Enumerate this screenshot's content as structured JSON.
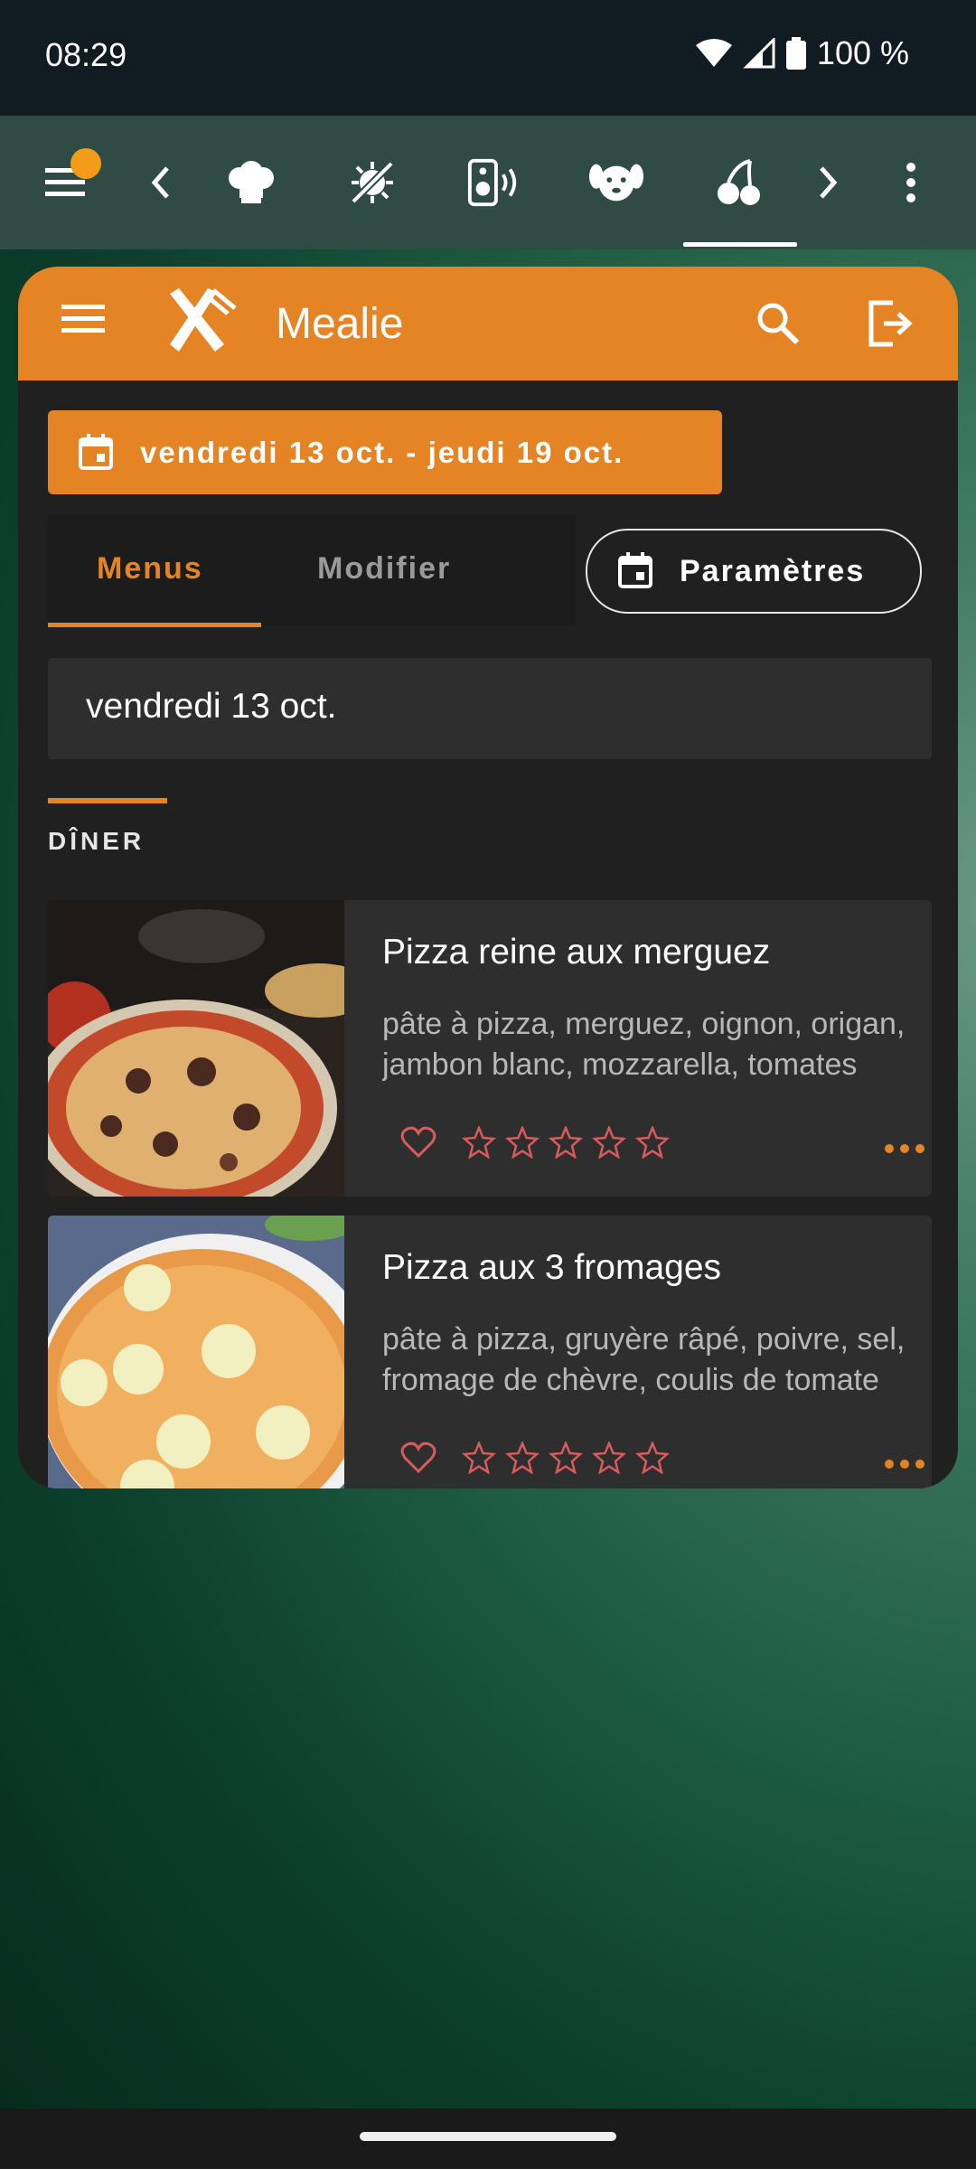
{
  "status_bar": {
    "time": "08:29",
    "battery": "100 %"
  },
  "top_tabs": {
    "icons": [
      "menu-icon",
      "chevron-left-icon",
      "chef-hat-icon",
      "no-virus-icon",
      "speaker-icon",
      "dog-icon",
      "cherries-icon",
      "chevron-right-icon",
      "more-vertical-icon"
    ],
    "active_index": 6
  },
  "app": {
    "title": "Mealie",
    "date_range": "vendredi 13 oct. - jeudi 19 oct.",
    "tabs": [
      {
        "label": "Menus"
      },
      {
        "label": "Modifier"
      }
    ],
    "settings_label": "Paramètres",
    "day": "vendredi 13 oct.",
    "section": "DÎNER",
    "recipes": [
      {
        "title": "Pizza reine aux merguez",
        "description": "pâte à pizza, merguez, oignon, origan, jambon blanc, mozzarella, tomates"
      },
      {
        "title": "Pizza aux 3 fromages",
        "description": "pâte à pizza, gruyère râpé, poivre, sel, fromage de chèvre, coulis de tomate"
      }
    ]
  },
  "colors": {
    "accent": "#e58424",
    "heart": "#d95c5c",
    "card_bg": "#202020"
  }
}
